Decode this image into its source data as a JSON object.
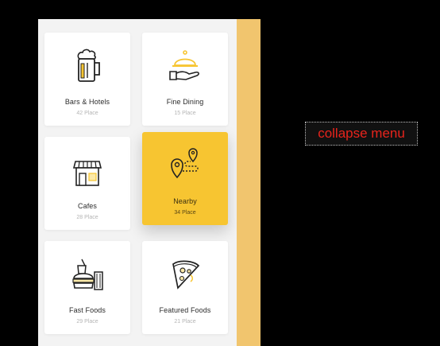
{
  "categories": [
    {
      "title": "Bars  & Hotels",
      "count": "42 Place",
      "icon": "beer-mug-icon"
    },
    {
      "title": "Fine Dining",
      "count": "15 Place",
      "icon": "cloche-hand-icon"
    },
    {
      "title": "Cafes",
      "count": "28 Place",
      "icon": "cafe-store-icon"
    },
    {
      "title": "Nearby",
      "count": "34 Place",
      "icon": "route-pin-icon",
      "active": true
    },
    {
      "title": "Fast Foods",
      "count": "29 Place",
      "icon": "burger-drink-icon"
    },
    {
      "title": "Featured Foods",
      "count": "21 Place",
      "icon": "pizza-slice-icon"
    }
  ],
  "collapse_menu_label": "collapse menu",
  "colors": {
    "accent": "#f7c531",
    "strip": "#f1c56e",
    "panel": "#f3f3f3",
    "collapse_text": "#e8241c"
  }
}
